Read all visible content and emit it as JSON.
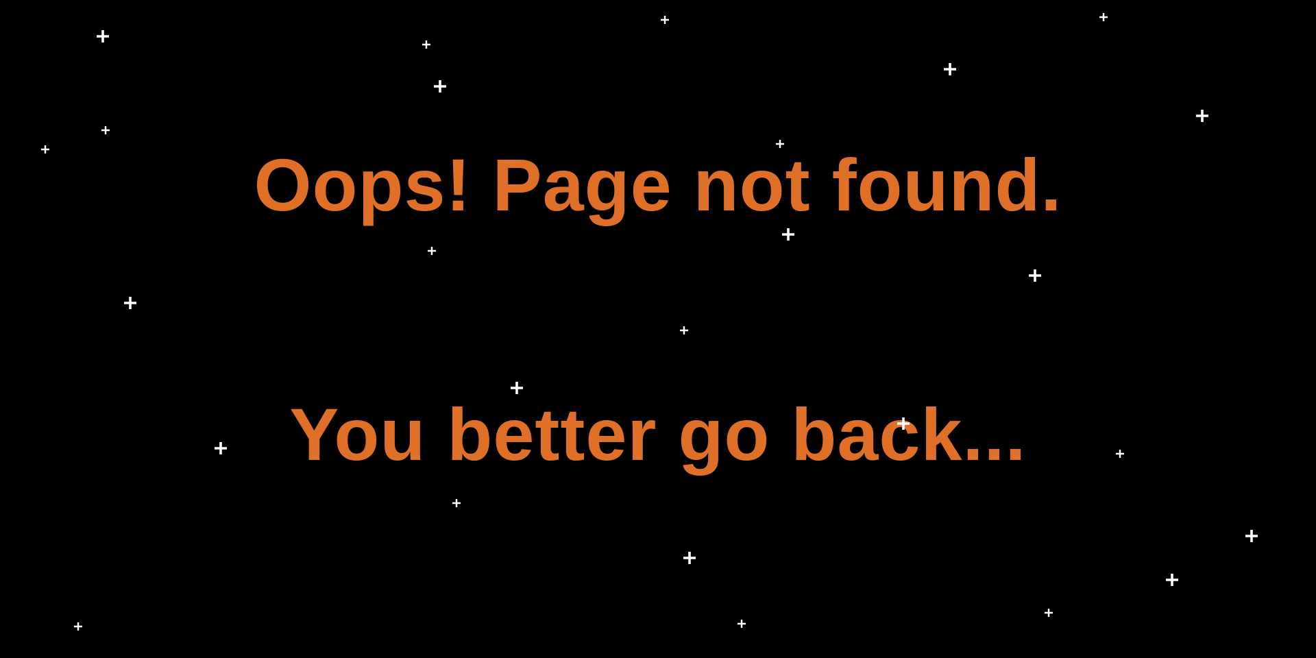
{
  "page": {
    "title_text": "Oops! Page not found.",
    "subtitle_text": "You better go back...",
    "text_color": "#e07028",
    "background_color": "#000000",
    "star_color": "#ffffff"
  }
}
